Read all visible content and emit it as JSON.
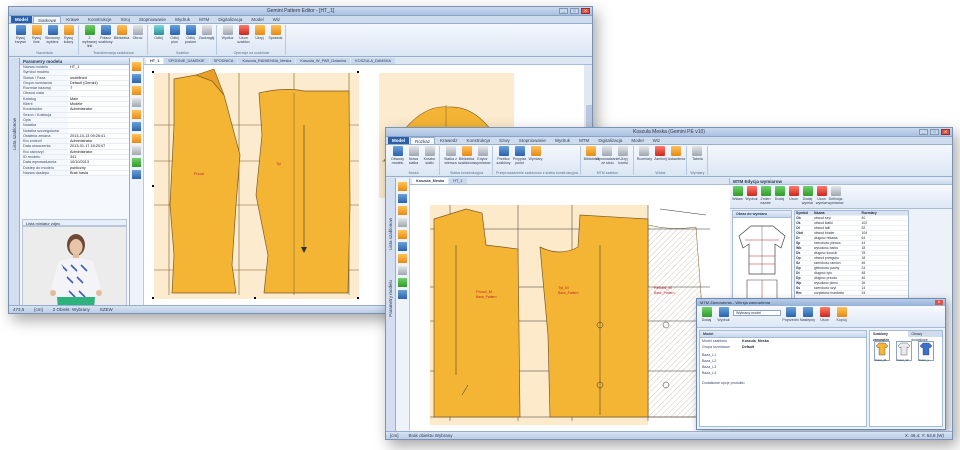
{
  "back_window": {
    "title": "Gemini Pattern Editor - [HT_1]",
    "tabs": [
      "Model",
      "Siatkowe",
      "Krawe",
      "Konstrukcje",
      "Stroj",
      "Stopniowanie",
      "Wydruk",
      "MTM",
      "Digitalizacja",
      "Model",
      "Wiz"
    ],
    "ribbon": [
      {
        "label": "Rysuj krzywe",
        "icon": "draw-curve-icon",
        "color": "blue"
      },
      {
        "label": "Rysuj linie",
        "icon": "draw-line-icon",
        "color": "orange"
      },
      {
        "label": "Skrocony wybierz",
        "icon": "select-icon",
        "color": "blue"
      },
      {
        "label": "Rysuj kolory",
        "icon": "palette-icon",
        "color": "orange"
      },
      {
        "label": "Z wybranej linii",
        "icon": "from-line-icon",
        "color": "green"
      },
      {
        "label": "Polacz szablony",
        "icon": "merge-icon",
        "color": "blue"
      },
      {
        "label": "Biblioteka",
        "icon": "library-icon",
        "color": "orange"
      },
      {
        "label": "Obroc",
        "icon": "rotate-icon",
        "color": "gray"
      },
      {
        "label": "Odbij",
        "icon": "mirror-icon",
        "color": "teal"
      },
      {
        "label": "Odbij pion",
        "icon": "flip-v-icon",
        "color": "blue"
      },
      {
        "label": "Odbij poziom",
        "icon": "flip-h-icon",
        "color": "blue"
      },
      {
        "label": "Zaokraglij",
        "icon": "round-icon",
        "color": "gray"
      },
      {
        "label": "Wydluz",
        "icon": "extend-icon",
        "color": "gray"
      },
      {
        "label": "Usun szablon",
        "icon": "delete-icon",
        "color": "red"
      },
      {
        "label": "Ukryj",
        "icon": "hide-icon",
        "color": "orange"
      },
      {
        "label": "Sprawdz",
        "icon": "check-icon",
        "color": "orange"
      }
    ],
    "ribbon_groups": [
      "Narzedzia",
      "Transformacja szablonow",
      "Szablon",
      "Operacje na szablonie"
    ],
    "panel_title": "Parametry modelu",
    "properties": [
      {
        "k": "Nazwa modelu",
        "v": "HT_1"
      },
      {
        "k": "Symbol modelu",
        "v": ""
      },
      {
        "k": "Status / Faza",
        "v": "undefined"
      },
      {
        "k": "Grupa rozmiarow",
        "v": "Default (Gemini)"
      },
      {
        "k": "Rozmiar bazowy",
        "v": "T"
      },
      {
        "k": "Obwod ciala",
        "v": ""
      },
      {
        "k": "Katalog",
        "v": "Main"
      },
      {
        "k": "Klient",
        "v": "Modele"
      },
      {
        "k": "Konstruktor",
        "v": "Administrator"
      },
      {
        "k": "Sezon / Kolekcja",
        "v": ""
      },
      {
        "k": "Opis",
        "v": ""
      },
      {
        "k": "Notatka",
        "v": ""
      },
      {
        "k": "Notatka szczegolowa",
        "v": ""
      },
      {
        "k": "Ostatnia zmiana",
        "v": "2013-10-13 09:26:41"
      },
      {
        "k": "Kto zmienil",
        "v": "Administrator"
      },
      {
        "k": "Data utworzenia",
        "v": "2013-01-17 16:20:07"
      },
      {
        "k": "Kto utworzyl",
        "v": "Administrator"
      },
      {
        "k": "ID modelu",
        "v": "341"
      },
      {
        "k": "Data wprowadzenia",
        "v": "10/10/2013"
      },
      {
        "k": "Dostep do modelu",
        "v": "publiczny"
      },
      {
        "k": "Nazwa dostepu",
        "v": "Brak hasla"
      }
    ],
    "photo_header": "Lista miniatur zdjec",
    "doc_tabs": [
      "HT_1",
      "SPODNIE_DAMSKIE",
      "SPODNICA",
      "Koszula_RAMIENNA_Meska",
      "Koszula_W_PAR_Dzianina",
      "KOSZULA_DAMSKA"
    ],
    "side_label": "Lista szablonow",
    "status": {
      "scale": "473,5",
      "units": "[cm]",
      "mode": "2 Obiekt: Wybrany",
      "right": "SZEW"
    }
  },
  "front_window": {
    "title": "Koszula Meska (Gemini PE v10)",
    "tabs": [
      "Model",
      "Rozkaz",
      "Krawedz",
      "Konstrukcja",
      "Szwy",
      "Stopniowanie",
      "Wydruk",
      "MTM",
      "Digitalizacja",
      "Model",
      "Wiz"
    ],
    "ribbon": [
      {
        "label": "Obwody modelu",
        "icon": "outline-icon",
        "color": "blue"
      },
      {
        "label": "Nowa siatka",
        "icon": "new-grid-icon",
        "color": "gray"
      },
      {
        "label": "Kreator siatki",
        "icon": "wizard-icon",
        "color": "gray"
      },
      {
        "label": "Siatka z wiersza",
        "icon": "grid-row-icon",
        "color": "gray"
      },
      {
        "label": "Biblioteka szablonow",
        "icon": "library-icon",
        "color": "orange"
      },
      {
        "label": "Edytor wymiarow",
        "icon": "measure-icon",
        "color": "gray"
      },
      {
        "label": "Przelicz szablony",
        "icon": "recalc-icon",
        "color": "blue"
      },
      {
        "label": "Przypisz punkt",
        "icon": "assign-point-icon",
        "color": "blue"
      },
      {
        "label": "Wymiary",
        "icon": "dimensions-icon",
        "color": "orange"
      },
      {
        "label": "Biblioteka",
        "icon": "library2-icon",
        "color": "orange"
      },
      {
        "label": "Wprowadzanie ze stolu",
        "icon": "table-input-icon",
        "color": "gray"
      },
      {
        "label": "Ukryj kontur",
        "icon": "hide-contour-icon",
        "color": "gray"
      },
      {
        "label": "Rozmiary",
        "icon": "sizes-icon",
        "color": "gray"
      },
      {
        "label": "Zamknij",
        "icon": "close-doc-icon",
        "color": "red"
      },
      {
        "label": "Ustawienia",
        "icon": "settings-icon",
        "color": "orange"
      },
      {
        "label": "Tabela",
        "icon": "table-icon",
        "color": "gray"
      }
    ],
    "ribbon_right": [
      "Prowadzenie szew",
      "Polacz przy szwie",
      "Szew x / pomiar"
    ],
    "ribbon_groups": [
      "Modul",
      "Siatka konstrukcyjna",
      "Przeprowadzenie szablonow z siatka konstrukcyjna",
      "MTM szablon",
      "Widok",
      "Wymiary"
    ],
    "doc_tabs": [
      "Koszula_Meska",
      "HT_1"
    ],
    "side_labels": [
      "Lista szablonow",
      "Parametry modelu"
    ],
    "piece_labels": [
      {
        "name": "Przod_M",
        "sub": "Base_Pattern"
      },
      {
        "name": "Tyl_M",
        "sub": "Base_Pattern"
      },
      {
        "name": "Rekaw_M",
        "sub": "Base_Pattern"
      }
    ],
    "mtm_panel": {
      "title": "MTM Edycja wymiarow",
      "toolbar": [
        "Wstaw",
        "Wydruk",
        "Zmien nazwe",
        "Dodaj",
        "Usun",
        "Dodaj wymiar",
        "Usun wymiar",
        "Definicja wymiarow"
      ],
      "image_title": "Obraz do wymiaru",
      "table_headers": [
        "Symbol",
        "Nazwa",
        "Rozmiary"
      ],
      "rows": [
        [
          "Ob",
          "obwod szyi",
          "40"
        ],
        [
          "Ok",
          "obwod klatki",
          "102"
        ],
        [
          "Ot",
          "obwod talii",
          "92"
        ],
        [
          "Obd",
          "obwod bioder",
          "104"
        ],
        [
          "Dr",
          "dlugosc rekawa",
          "64"
        ],
        [
          "Sp",
          "szerokosc plecow",
          "44"
        ],
        [
          "Wb",
          "wysokosc barku",
          "18"
        ],
        [
          "Dk",
          "dlugosc koszuli",
          "78"
        ],
        [
          "Op",
          "obwod przegubu",
          "18"
        ],
        [
          "Sz",
          "szerokosc ramion",
          "46"
        ],
        [
          "Gp",
          "glebokosc pachy",
          "24"
        ],
        [
          "Dt",
          "dlugosc tylu",
          "48"
        ],
        [
          "Dp",
          "dlugosc przodu",
          "46"
        ],
        [
          "Wp",
          "wysokosc piersi",
          "26"
        ],
        [
          "Ss",
          "szerokosc szyi",
          "14"
        ],
        [
          "Rm",
          "rozpietosc mankietu",
          "24"
        ]
      ]
    },
    "dialog": {
      "title": "MTM Zamowienia - Wersja zamowienia",
      "select_value": "Wybrany model",
      "toolbar": [
        "Dodaj",
        "Wydruk",
        "Poprzedni",
        "Nastepny",
        "Usun",
        "Kopiuj"
      ],
      "section_left": "Model",
      "model_key": "Model szablonu",
      "model_value": "Koszula_Meska",
      "grupa_key": "Grupa rozmiarow",
      "grupa_value": "Default",
      "table_label": "Dodatkowe opcje produktu",
      "size_rows": [
        "Baza_L1",
        "Baza_L2",
        "Baza_L3",
        "Baza_L4"
      ],
      "tabs_right": [
        "Szablony zamowien",
        "Obrazy dodatkowe"
      ],
      "thumb_labels": [
        "Kolor_M",
        "Kolor_W",
        "Kolor_L"
      ]
    },
    "status": {
      "scale": "",
      "units": "[cm]",
      "mode": "Brak obiektu Wybrany",
      "right": "X: 46,4; Y: 53,8 (W)"
    }
  }
}
